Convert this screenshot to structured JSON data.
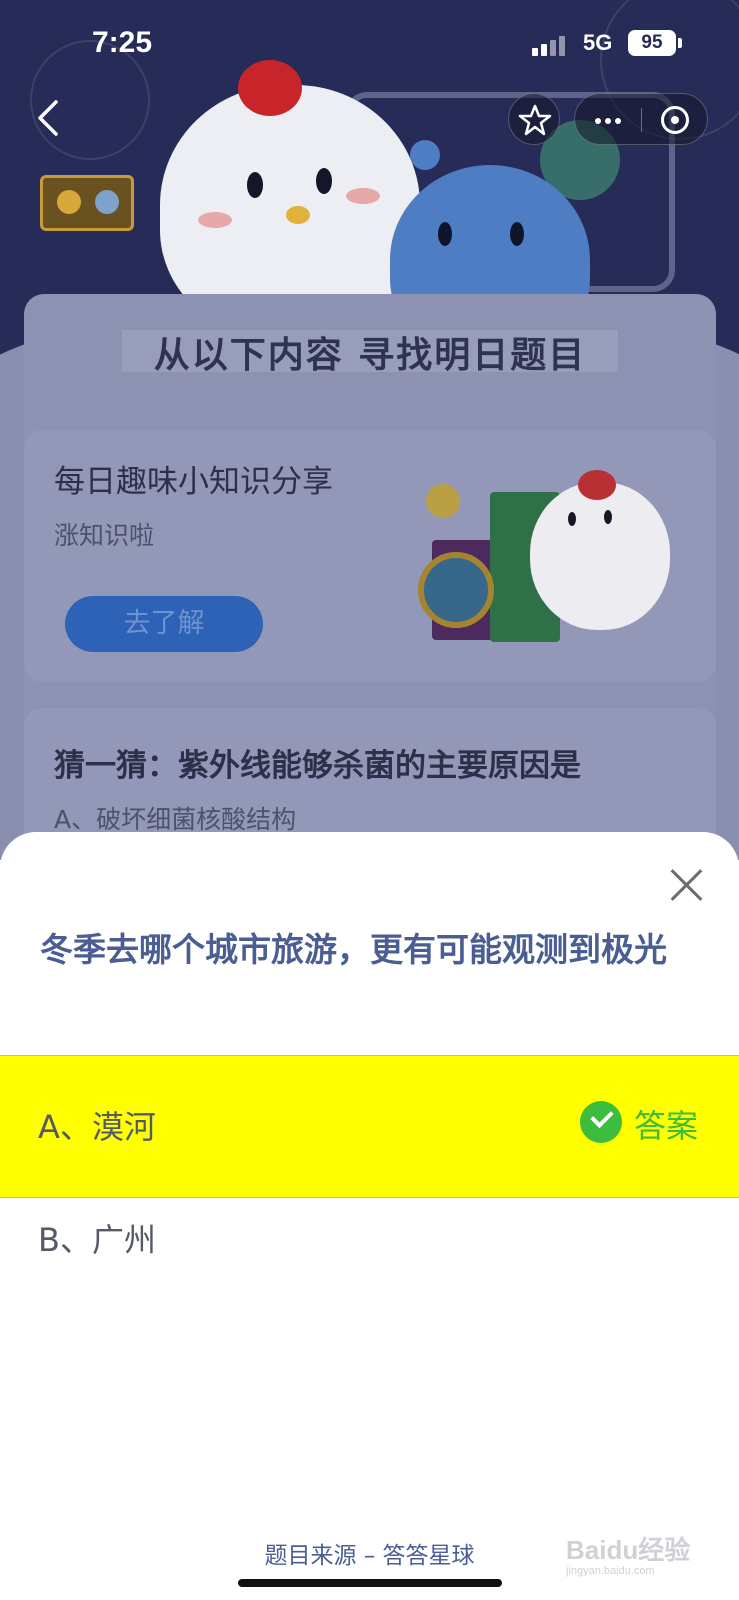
{
  "status_bar": {
    "time": "7:25",
    "network": "5G",
    "battery": "95"
  },
  "nav": {
    "back_icon": "chevron-left-icon",
    "favorite_icon": "star-icon",
    "more_icon": "more-dots-icon",
    "close_mini_icon": "target-icon"
  },
  "background": {
    "panel_title": "从以下内容  寻找明日题目",
    "card1": {
      "title": "每日趣味小知识分享",
      "subtitle": "涨知识啦",
      "button": "去了解"
    },
    "card2": {
      "title": "猜一猜：紫外线能够杀菌的主要原因是",
      "option": "A、破坏细菌核酸结构"
    }
  },
  "sheet": {
    "question": "冬季去哪个城市旅游，更有可能观测到极光",
    "options": [
      {
        "label": "A、漠河",
        "is_answer": true,
        "answer_label": "答案",
        "highlight_color": "#ffff00"
      },
      {
        "label": "B、广州",
        "is_answer": false
      }
    ],
    "source": "题目来源 – 答答星球"
  },
  "watermark": {
    "brand": "Baidu经验",
    "url": "jingyan.baidu.com"
  },
  "colors": {
    "hero_bg": "#272b58",
    "question_text": "#4a5e94",
    "answer_green": "#3dbd3d",
    "highlight": "#ffff00"
  }
}
